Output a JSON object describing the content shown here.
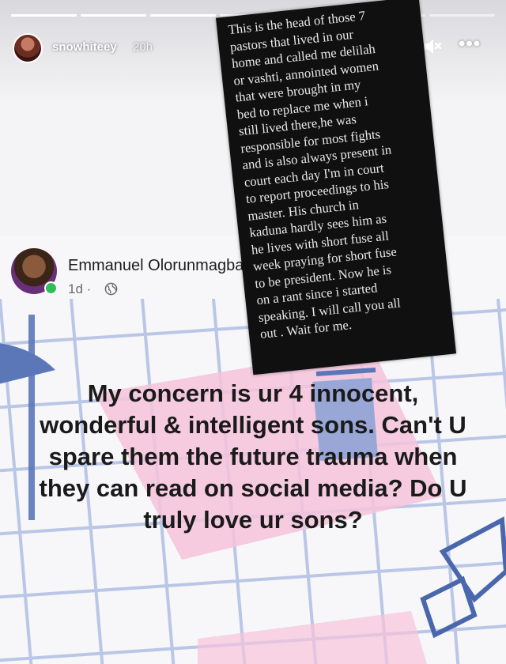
{
  "story": {
    "progress": [
      1,
      1,
      1,
      1,
      1,
      0.55,
      0
    ],
    "username": "snowhiteey",
    "time_ago": "20h",
    "more_label": "•••"
  },
  "post": {
    "author": "Emmanuel Olorunmagba",
    "age": "1d",
    "meta_sep": "·",
    "message": "My concern is ur 4 innocent, wonderful & intelligent sons. Can't U spare them the future trauma when they can read on social media? Do U truly love ur sons?"
  },
  "overlay": {
    "lines": [
      "This is the head of those 7",
      "pastors that lived in our",
      "home and called me delilah",
      "or vashti, annointed women",
      "that were brought in my",
      "bed to replace me when i",
      "still lived there,he was",
      "responsible for most fights",
      "and is also always present in",
      "court each day I'm in court",
      "to report proceedings to his",
      "master. His church in",
      "kaduna hardly sees him as",
      "he lives with short fuse all",
      "week praying for short fuse",
      "to be president. Now he is",
      "on a rant since i started",
      "speaking. I will call you all",
      "out . Wait for me."
    ]
  },
  "colors": {
    "online": "#2ebd59",
    "card": "#101010",
    "grid": "#b9c6e6",
    "pink": "#f4bdd6",
    "blue": "#5b77b8"
  }
}
